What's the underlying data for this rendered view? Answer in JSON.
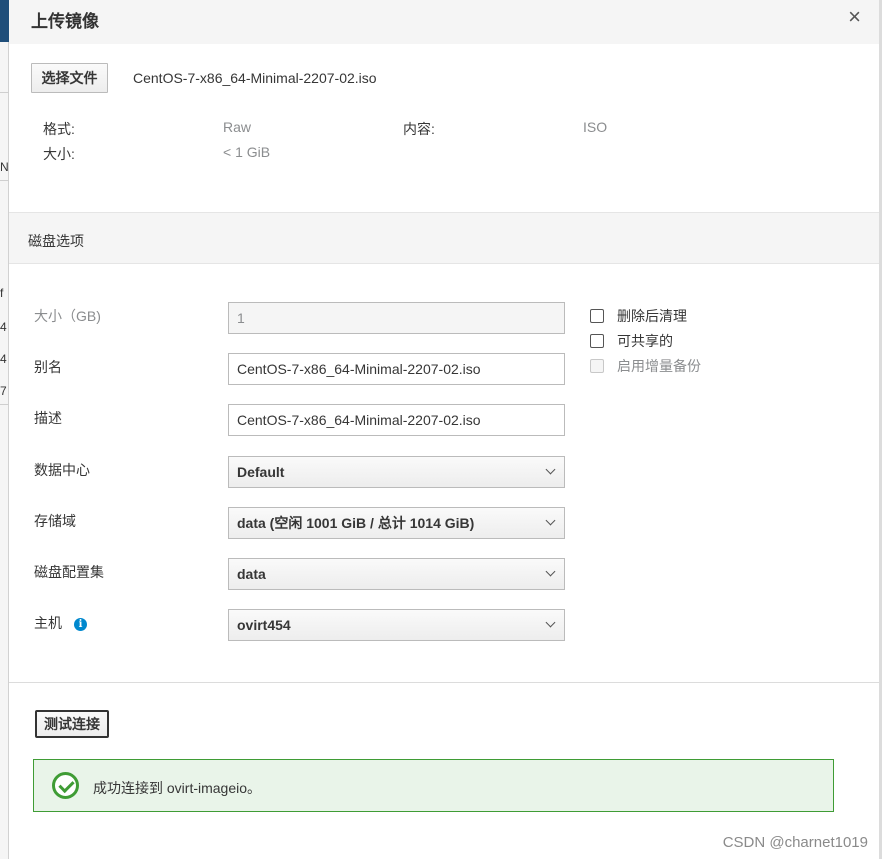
{
  "dialog": {
    "title": "上传镜像",
    "close_symbol": "×"
  },
  "file": {
    "choose_label": "选择文件",
    "file_name": "CentOS-7-x86_64-Minimal-2207-02.iso"
  },
  "info": {
    "format_label": "格式:",
    "format_value": "Raw",
    "content_label": "内容:",
    "content_value": "ISO",
    "size_label": "大小:",
    "size_value": "< 1 GiB"
  },
  "disk_options": {
    "section_title": "磁盘选项",
    "size_label": "大小（GB)",
    "size_value": "1",
    "alias_label": "别名",
    "alias_value": "CentOS-7-x86_64-Minimal-2207-02.iso",
    "description_label": "描述",
    "description_value": "CentOS-7-x86_64-Minimal-2207-02.iso",
    "datacenter_label": "数据中心",
    "datacenter_value": "Default",
    "storage_label": "存储域",
    "storage_value": "data (空闲 1001 GiB / 总计 1014 GiB)",
    "profile_label": "磁盘配置集",
    "profile_value": "data",
    "host_label": "主机",
    "host_value": "ovirt454",
    "checkboxes": {
      "wipe_after_delete": "删除后清理",
      "shareable": "可共享的",
      "incremental_backup": "启用增量备份"
    }
  },
  "test": {
    "button_label": "测试连接",
    "success_message": "成功连接到 ovirt-imageio。"
  },
  "background": {
    "chars": [
      "N",
      "f",
      "4",
      "4",
      "7"
    ]
  },
  "watermark": "CSDN @charnet1019",
  "colors": {
    "success": "#3f9c35",
    "info_icon": "#0088ce",
    "header_bg": "#f5f5f5"
  }
}
